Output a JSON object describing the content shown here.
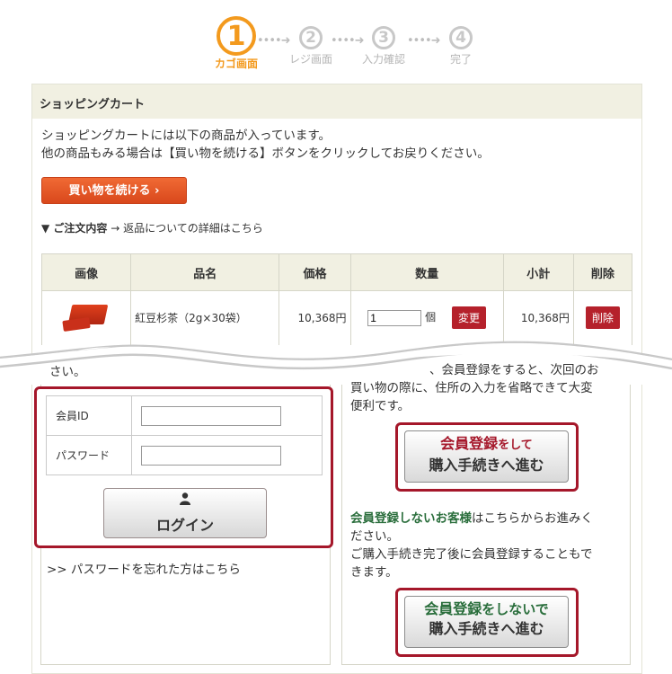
{
  "steps": [
    {
      "num": "1",
      "label": "カゴ画面",
      "active": true
    },
    {
      "num": "2",
      "label": "レジ画面",
      "active": false
    },
    {
      "num": "3",
      "label": "入力確認",
      "active": false
    },
    {
      "num": "4",
      "label": "完了",
      "active": false
    }
  ],
  "step_arrow": "••••➜",
  "panel": {
    "title": "ショッピングカート",
    "intro_line1": "ショッピングカートには以下の商品が入っています。",
    "intro_line2": "他の商品もみる場合は【買い物を続ける】ボタンをクリックしてお戻りください。",
    "continue_button": "買い物を続ける ›",
    "order_label": "▼ ご注文内容",
    "return_link": "→ 返品についての詳細はこちら"
  },
  "cart": {
    "headers": [
      "画像",
      "品名",
      "価格",
      "数量",
      "小計",
      "削除"
    ],
    "row": {
      "name": "紅豆杉茶（2g×30袋）",
      "price": "10,368円",
      "qty": "1",
      "qty_unit": "個",
      "change_button": "変更",
      "subtotal": "10,368円",
      "delete_button": "削除"
    }
  },
  "login": {
    "partial_text": "さい。",
    "member_id_label": "会員ID",
    "password_label": "パスワード",
    "login_icon": "person-icon",
    "login_button": "ログイン",
    "forgot_link": ">> パスワードを忘れた方はこちら"
  },
  "register": {
    "text_line1": "、会員登録をすると、次回のお",
    "text_line2": "買い物の際に、住所の入力を省略できて大変",
    "text_line3": "便利です。",
    "button_line1_strong": "会員登録",
    "button_line1_small": "をして",
    "button_line2": "購入手続きへ進む"
  },
  "guest": {
    "strong": "会員登録しないお客様",
    "text1": "はこちらからお進みく",
    "text2": "ださい。",
    "text3": "ご購入手続き完了後に会員登録することもで",
    "text4": "きます。",
    "button_line1_strong": "会員登録",
    "button_line1_small": "をしないで",
    "button_line2": "購入手続きへ進む"
  },
  "colors": {
    "accent_orange": "#f39a1e",
    "button_red": "#b5212b",
    "frame_red": "#a5172a",
    "guest_green": "#2a6e3c",
    "header_beige": "#f1f0e2"
  }
}
